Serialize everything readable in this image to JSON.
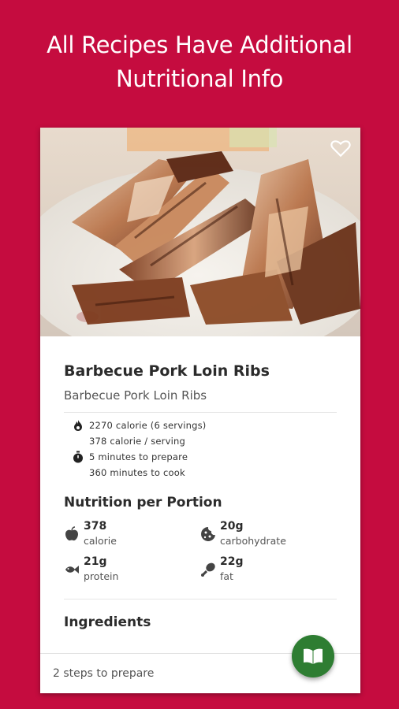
{
  "promo": {
    "line1": "All Recipes Have Additional",
    "line2": "Nutritional Info"
  },
  "recipe": {
    "title": "Barbecue Pork Loin Ribs",
    "subtitle": "Barbecue Pork Loin Ribs",
    "favorite_icon": "heart-outline-icon",
    "photo_icon": "food-photo"
  },
  "stats": {
    "total_calories": "2270 calorie (6 servings)",
    "per_serving": "378 calorie / serving",
    "prep_time": "5 minutes to prepare",
    "cook_time": "360 minutes to cook",
    "calorie_icon": "flame-icon",
    "time_icon": "stopwatch-icon"
  },
  "nutrition": {
    "heading": "Nutrition per Portion",
    "items": [
      {
        "value": "378",
        "label": "calorie",
        "icon": "apple-icon"
      },
      {
        "value": "20g",
        "label": "carbohydrate",
        "icon": "cookie-icon"
      },
      {
        "value": "21g",
        "label": "protein",
        "icon": "fish-icon"
      },
      {
        "value": "22g",
        "label": "fat",
        "icon": "drumstick-icon"
      }
    ]
  },
  "ingredients": {
    "heading": "Ingredients"
  },
  "footer": {
    "steps": "2 steps to prepare",
    "fab_icon": "book-icon"
  },
  "colors": {
    "background": "#c50c3f",
    "fab": "#2e7d32",
    "card": "#ffffff"
  }
}
